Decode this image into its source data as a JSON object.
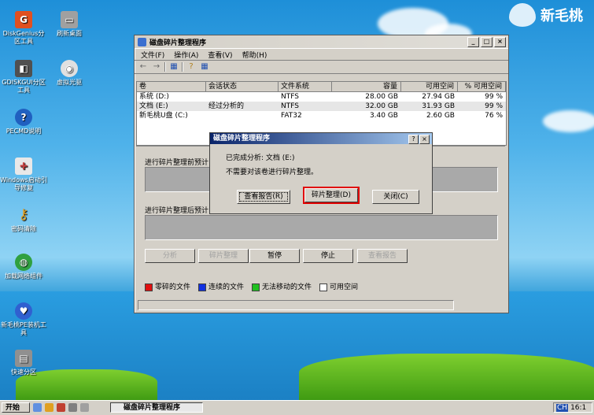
{
  "desktop": {
    "icons": [
      {
        "label": "DiskGenius分区工具",
        "icon": "disk-icon",
        "color": "#e05020"
      },
      {
        "label": "刷新桌面",
        "icon": "printer-icon",
        "color": "#808080"
      },
      {
        "label": "GDISKGUI分区工具",
        "icon": "gdisk-icon",
        "color": "#606060"
      },
      {
        "label": "虚拟光驱",
        "icon": "cd-icon",
        "color": "#b0b0b0"
      },
      {
        "label": "PECMD说明",
        "icon": "help-icon",
        "color": "#2060c0"
      },
      {
        "label": "Windows启动引导修复",
        "icon": "toolbox-icon",
        "color": "#c04040"
      },
      {
        "label": "密码清除",
        "icon": "key-icon",
        "color": "#e0a020"
      },
      {
        "label": "加载网络组件",
        "icon": "globe-icon",
        "color": "#30a040"
      },
      {
        "label": "新毛桃PE装机工具",
        "icon": "install-icon",
        "color": "#3060d0"
      },
      {
        "label": "快速分区",
        "icon": "partition-icon",
        "color": "#909090"
      }
    ],
    "brand": "新毛桃"
  },
  "window": {
    "title": "磁盘碎片整理程序",
    "menu": [
      "文件(F)",
      "操作(A)",
      "查看(V)",
      "帮助(H)"
    ],
    "columns": [
      "卷",
      "会话状态",
      "文件系统",
      "容量",
      "可用空间",
      "% 可用空间"
    ],
    "rows": [
      {
        "vol": "系统 (D:)",
        "status": "",
        "fs": "NTFS",
        "cap": "28.00 GB",
        "free": "27.94 GB",
        "pct": "99 %"
      },
      {
        "vol": "文档 (E:)",
        "status": "经过分析的",
        "fs": "NTFS",
        "cap": "32.00 GB",
        "free": "31.93 GB",
        "pct": "99 %"
      },
      {
        "vol": "新毛桃U盘 (C:)",
        "status": "",
        "fs": "FAT32",
        "cap": "3.40 GB",
        "free": "2.60 GB",
        "pct": "76 %"
      }
    ],
    "before_label": "进行碎片整理前预计",
    "after_label": "进行碎片整理后预计",
    "buttons": [
      "分析",
      "碎片整理",
      "暂停",
      "停止",
      "查看报告"
    ],
    "legend": [
      {
        "label": "零碎的文件",
        "color": "#e01010"
      },
      {
        "label": "连续的文件",
        "color": "#1030e0"
      },
      {
        "label": "无法移动的文件",
        "color": "#20c020"
      },
      {
        "label": "可用空间",
        "color": "#ffffff"
      }
    ]
  },
  "dialog": {
    "title": "磁盘碎片整理程序",
    "help": "?",
    "close": "×",
    "line1": "已完成分析: 文档 (E:)",
    "line2": "不需要对该卷进行碎片整理。",
    "btn_report": "查看报告(R)",
    "btn_defrag": "碎片整理(D)",
    "btn_close": "关闭(C)",
    "highlight_color": "#e00000"
  },
  "taskbar": {
    "start": "开始",
    "task": "磁盘碎片整理程序",
    "tray_text": "CH",
    "clock": "16:1"
  }
}
